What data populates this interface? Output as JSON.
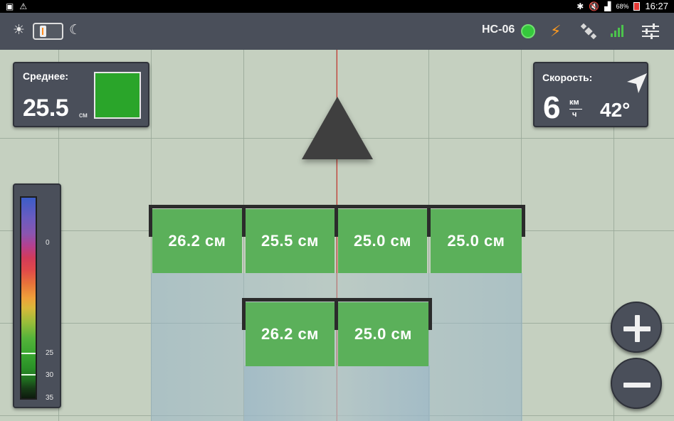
{
  "status_bar": {
    "battery_percent": "68%",
    "clock": "16:27"
  },
  "toolbar": {
    "device_name": "НС-06",
    "connection_color": "#35c93c",
    "theme_toggle_state": "day"
  },
  "avg_panel": {
    "label": "Среднее:",
    "value": "25.5",
    "unit": "см",
    "swatch_color": "#2aa52a"
  },
  "speed_panel": {
    "label": "Скорость:",
    "value": "6",
    "unit_top": "км",
    "unit_bottom": "ч",
    "heading": "42°"
  },
  "legend": {
    "labels": [
      "0",
      "25",
      "30",
      "35"
    ]
  },
  "boom_front": {
    "sections": [
      "26.2 см",
      "25.5 см",
      "25.0 см",
      "25.0 см"
    ]
  },
  "boom_rear": {
    "sections": [
      "26.2 см",
      "25.0 см"
    ]
  },
  "colors": {
    "accent_orange": "#ff9a1f",
    "section_green": "#5bb05a",
    "center_line": "#e0302a"
  }
}
